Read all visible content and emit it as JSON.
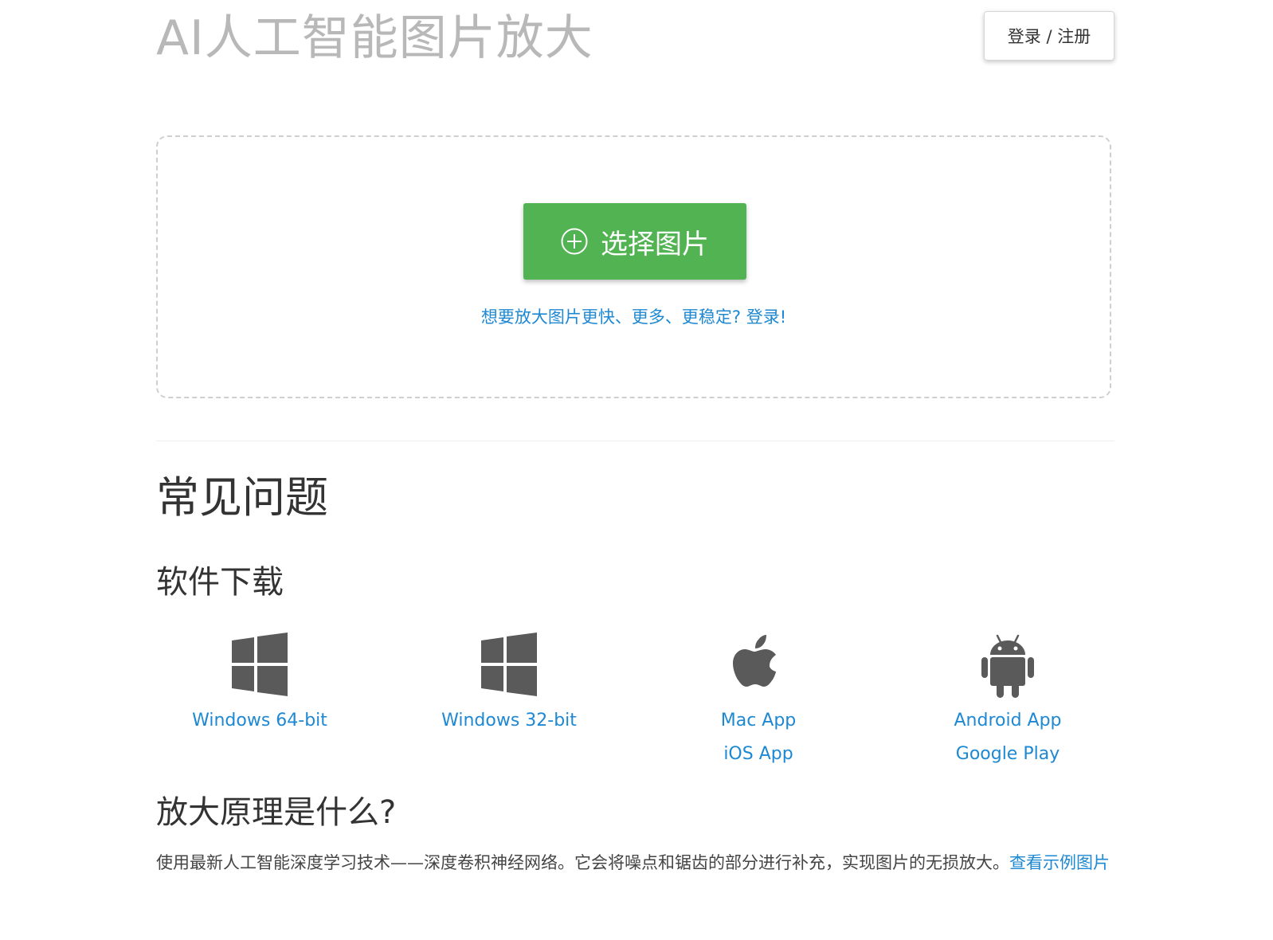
{
  "header": {
    "title": "AI人工智能图片放大",
    "login_label": "登录 / 注册"
  },
  "upload": {
    "select_label": "选择图片",
    "login_hint": "想要放大图片更快、更多、更稳定? 登录!"
  },
  "faq": {
    "title": "常见问题",
    "download_title": "软件下载",
    "downloads": [
      {
        "icon": "windows-icon",
        "links": [
          "Windows 64-bit"
        ]
      },
      {
        "icon": "windows-icon",
        "links": [
          "Windows 32-bit"
        ]
      },
      {
        "icon": "apple-icon",
        "links": [
          "Mac App",
          "iOS App"
        ]
      },
      {
        "icon": "android-icon",
        "links": [
          "Android App",
          "Google Play"
        ]
      }
    ],
    "principle_title": "放大原理是什么?",
    "principle_text": "使用最新人工智能深度学习技术——深度卷积神经网络。它会将噪点和锯齿的部分进行补充，实现图片的无损放大。",
    "principle_link": "查看示例图片"
  },
  "colors": {
    "accent_green": "#52b352",
    "link_blue": "#1e88d2",
    "title_gray": "#b8b8b8",
    "icon_gray": "#5a5a5a"
  }
}
